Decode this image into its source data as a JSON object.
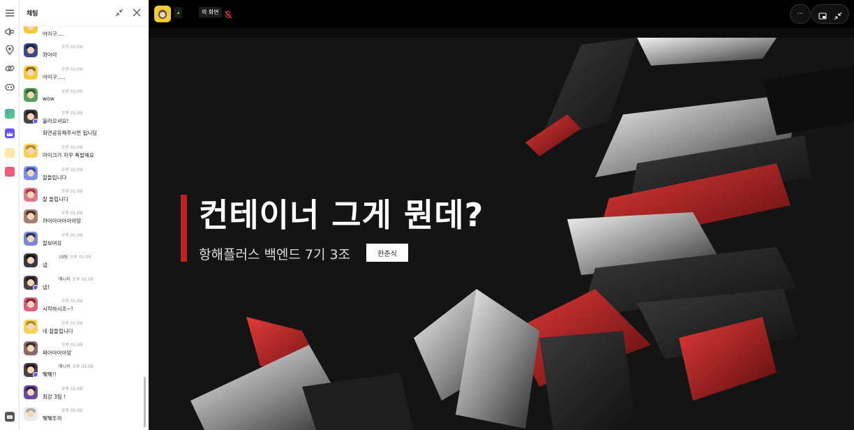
{
  "chat": {
    "title": "채팅",
    "messages": [
      {
        "name": "",
        "time": "",
        "text": "어이구....",
        "text2": "",
        "avatar": "yellow",
        "badge": false
      },
      {
        "name": "",
        "time": "오후 01:09",
        "text": "와아아",
        "text2": "",
        "avatar": "navy",
        "badge": false
      },
      {
        "name": "",
        "time": "오후 01:09",
        "text": "아이구.....",
        "text2": "",
        "avatar": "yellow",
        "badge": false
      },
      {
        "name": "",
        "time": "오후 01:09",
        "text": "wow",
        "text2": "",
        "avatar": "green",
        "badge": false
      },
      {
        "name": "",
        "time": "오후 01:09",
        "text": "올라오셔요!",
        "text2": "화면공유해주시면 됩니당",
        "avatar": "dark",
        "badge": true
      },
      {
        "name": "",
        "time": "오후 01:09",
        "text": "마이크가 자꾸 폭발해요",
        "text2": "",
        "avatar": "yellow2",
        "badge": false
      },
      {
        "name": "",
        "time": "오후 01:09",
        "text": "잘들립니다",
        "text2": "",
        "avatar": "blue",
        "badge": false
      },
      {
        "name": "",
        "time": "오후 01:09",
        "text": "잘 들립니다",
        "text2": "",
        "avatar": "pink",
        "badge": false
      },
      {
        "name": "",
        "time": "오후 01:09",
        "text": "까아아아아아아앙",
        "text2": "",
        "avatar": "brown",
        "badge": false
      },
      {
        "name": "",
        "time": "오후 01:09",
        "text": "잘보여유",
        "text2": "",
        "avatar": "blue2",
        "badge": false
      },
      {
        "name": "19팀",
        "time": "오후 01:09",
        "text": "넵",
        "text2": "",
        "avatar": "dark2",
        "badge": false
      },
      {
        "name": "매니저",
        "time": "오후 01:09",
        "text": "넵!",
        "text2": "",
        "avatar": "dark",
        "badge": true
      },
      {
        "name": "",
        "time": "오후 01:09",
        "text": "시작하시조~!",
        "text2": "",
        "avatar": "pink2",
        "badge": false
      },
      {
        "name": "",
        "time": "오후 01:09",
        "text": "네 잘들립니다",
        "text2": "",
        "avatar": "yellow2",
        "badge": false
      },
      {
        "name": "",
        "time": "오후 01:09",
        "text": "짜아아아아앙",
        "text2": "",
        "avatar": "brown2",
        "badge": false
      },
      {
        "name": "매니저",
        "time": "오후 01:09",
        "text": "뛖뛖!!",
        "text2": "",
        "avatar": "dark",
        "badge": true
      },
      {
        "name": "",
        "time": "오후 01:09",
        "text": "최강 3팀 !",
        "text2": "",
        "avatar": "purple",
        "badge": false
      },
      {
        "name": "",
        "time": "오후 01:09",
        "text": "뛖뛖뚜까",
        "text2": "",
        "avatar": "light",
        "badge": false
      }
    ]
  },
  "stage": {
    "share_label": "의 화면",
    "more_label": "···",
    "slide": {
      "title": "컨테이너 그게 뭔데?",
      "subtitle": "항해플러스 백엔드 7기 3조",
      "presenter": "한춘식"
    }
  },
  "colors": {
    "accent_red": "#c1201f",
    "badge_purple": "#6b53ff",
    "host_yellow": "#f6c939"
  },
  "icons": {
    "rail": [
      "menu-icon",
      "megaphone-icon",
      "location-pin-icon",
      "link-icon",
      "gamepad-icon"
    ],
    "apps": [
      "landscape-app-icon",
      "crown-app-icon",
      "sparkle-app-icon",
      "pencil-app-icon"
    ],
    "chat_header": [
      "collapse-icon",
      "close-icon"
    ],
    "topbar": [
      "more-icon",
      "pip-icon",
      "minimize-icon",
      "mic-off-icon"
    ]
  }
}
